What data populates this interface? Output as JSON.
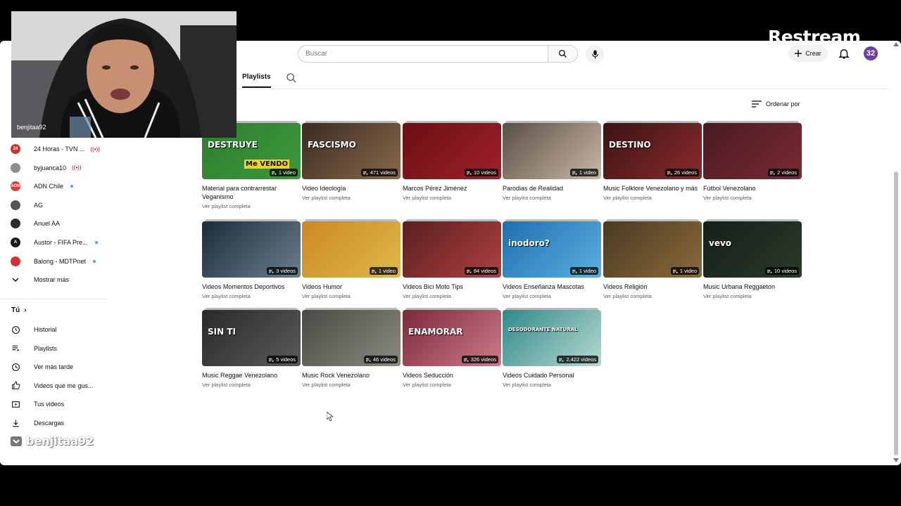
{
  "header": {
    "search_placeholder": "Buscar",
    "create_label": "Crear",
    "avatar_text": "32"
  },
  "tabs": {
    "playlists_label": "Playlists"
  },
  "sort_label": "Ordenar por",
  "sidebar": {
    "subscriptions": [
      {
        "label": "24 Horas - TVN ...",
        "avatar_text": "24",
        "indicator": "live",
        "color": "#d32f2f"
      },
      {
        "label": "byjuanca10",
        "avatar_text": "",
        "indicator": "live",
        "color": "#8d8d8d"
      },
      {
        "label": "ADN Chile",
        "avatar_text": "ADN",
        "indicator": "dot",
        "color": "#e53935"
      },
      {
        "label": "AG",
        "avatar_text": "",
        "indicator": "none",
        "color": "#555555"
      },
      {
        "label": "Anuel AA",
        "avatar_text": "",
        "indicator": "none",
        "color": "#2b2b2b"
      },
      {
        "label": "Austor - FIFA Pre...",
        "avatar_text": "A",
        "indicator": "dot",
        "color": "#1a1a1a"
      },
      {
        "label": "Balong - MDTPnet",
        "avatar_text": "",
        "indicator": "dot",
        "color": "#d32f2f"
      }
    ],
    "show_more": "Mostrar más",
    "you_label": "Tú",
    "you_items": [
      {
        "label": "Historial",
        "icon": "history-icon"
      },
      {
        "label": "Playlists",
        "icon": "playlists-icon"
      },
      {
        "label": "Ver más tarde",
        "icon": "clock-icon"
      },
      {
        "label": "Videos que me gus...",
        "icon": "thumbs-up-icon"
      },
      {
        "label": "Tus videos",
        "icon": "play-square-icon"
      },
      {
        "label": "Descargas",
        "icon": "download-icon"
      }
    ]
  },
  "playlist_subtitle": "Ver playlist completa",
  "playlists": [
    {
      "title": "Material para contrarrestar Veganismo",
      "count": "1 video",
      "colors": [
        "#2f7d2f",
        "#3a9a3a"
      ],
      "thumb_text": "DESTRUYE",
      "thumb_text2": "Me VENDO"
    },
    {
      "title": "Video Ideología",
      "count": "471 videos",
      "colors": [
        "#3a2a22",
        "#8a6a4a"
      ],
      "thumb_text": "FASCISMO",
      "thumb_text2": ""
    },
    {
      "title": "Marcos Pérez Jiménez",
      "count": "10 videos",
      "colors": [
        "#6a0f14",
        "#a0202a"
      ],
      "thumb_text": "",
      "thumb_text2": ""
    },
    {
      "title": "Parodias de Realidad",
      "count": "1 video",
      "colors": [
        "#5a4f46",
        "#c9b8a6"
      ],
      "thumb_text": "",
      "thumb_text2": ""
    },
    {
      "title": "Music Folklore Venezolano y más",
      "count": "26 videos",
      "colors": [
        "#3a1414",
        "#8c2a2a"
      ],
      "thumb_text": "DESTINO",
      "thumb_text2": ""
    },
    {
      "title": "Fútbol Venezolano",
      "count": "2 videos",
      "colors": [
        "#4a1a22",
        "#7a2a32"
      ],
      "thumb_text": "",
      "thumb_text2": ""
    },
    {
      "title": "Videos Momentos Deportivos",
      "count": "3 videos",
      "colors": [
        "#1d2b3a",
        "#6a7f90"
      ],
      "thumb_text": "",
      "thumb_text2": ""
    },
    {
      "title": "Videos Humor",
      "count": "1 video",
      "colors": [
        "#c98a22",
        "#e0b84a"
      ],
      "thumb_text": "",
      "thumb_text2": ""
    },
    {
      "title": "Videos Bici Moto Tips",
      "count": "84 videos",
      "colors": [
        "#5a1f1f",
        "#b04040"
      ],
      "thumb_text": "",
      "thumb_text2": ""
    },
    {
      "title": "Videos Enseñanza Mascotas",
      "count": "1 video",
      "colors": [
        "#1f6fb0",
        "#5ab0e0"
      ],
      "thumb_text": "inodoro?",
      "thumb_text2": ""
    },
    {
      "title": "Videos Religión",
      "count": "1 video",
      "colors": [
        "#4a3a22",
        "#8a6a3a"
      ],
      "thumb_text": "",
      "thumb_text2": ""
    },
    {
      "title": "Music Urbana Reggaeton",
      "count": "10 videos",
      "colors": [
        "#142018",
        "#2a3a2a"
      ],
      "thumb_text": "vevo",
      "thumb_text2": ""
    },
    {
      "title": "Music Reggae Venezolano",
      "count": "5 videos",
      "colors": [
        "#2a2a2a",
        "#5a5a5a"
      ],
      "thumb_text": "SIN TI",
      "thumb_text2": ""
    },
    {
      "title": "Music Rock Venezolano",
      "count": "46 videos",
      "colors": [
        "#4a4a44",
        "#8a8a80"
      ],
      "thumb_text": "",
      "thumb_text2": ""
    },
    {
      "title": "Videos Seducción",
      "count": "326 videos",
      "colors": [
        "#7a2a3a",
        "#d07a8a"
      ],
      "thumb_text": "ENAMORAR",
      "thumb_text2": ""
    },
    {
      "title": "Videos Cuidado Personal",
      "count": "2,422 videos",
      "colors": [
        "#2f8a8a",
        "#b8d8d0"
      ],
      "thumb_text": "DESODORANTE NATURAL",
      "thumb_text2": ""
    }
  ],
  "overlay": {
    "webcam_name": "benjitaa92",
    "restream_logo": "Restream",
    "bottom_handle": "benjitaa92"
  }
}
